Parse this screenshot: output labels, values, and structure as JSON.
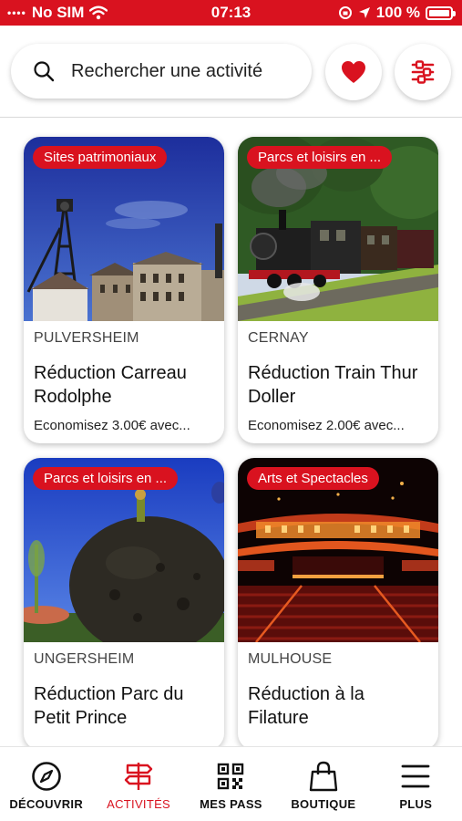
{
  "status_bar": {
    "carrier": "No SIM",
    "time": "07:13",
    "battery": "100 %"
  },
  "search": {
    "placeholder": "Rechercher une activité"
  },
  "colors": {
    "accent": "#d9121f"
  },
  "activities": [
    {
      "category": "Sites patrimoniaux",
      "city": "PULVERSHEIM",
      "title": "Réduction Carreau Rodolphe",
      "saving": "Economisez 3.00€ avec..."
    },
    {
      "category": "Parcs et loisirs en ...",
      "city": "CERNAY",
      "title": "Réduction Train Thur Doller",
      "saving": "Economisez 2.00€ avec..."
    },
    {
      "category": "Parcs et loisirs en ...",
      "city": "UNGERSHEIM",
      "title": "Réduction Parc du Petit Prince",
      "saving": ""
    },
    {
      "category": "Arts et Spectacles",
      "city": "MULHOUSE",
      "title": "Réduction à la Filature",
      "saving": ""
    }
  ],
  "bottom_nav": [
    {
      "label": "DÉCOUVRIR",
      "icon": "compass-icon",
      "active": false
    },
    {
      "label": "ACTIVITÉS",
      "icon": "signpost-icon",
      "active": true
    },
    {
      "label": "MES PASS",
      "icon": "qr-code-icon",
      "active": false
    },
    {
      "label": "BOUTIQUE",
      "icon": "shopping-bag-icon",
      "active": false
    },
    {
      "label": "PLUS",
      "icon": "menu-icon",
      "active": false
    }
  ]
}
